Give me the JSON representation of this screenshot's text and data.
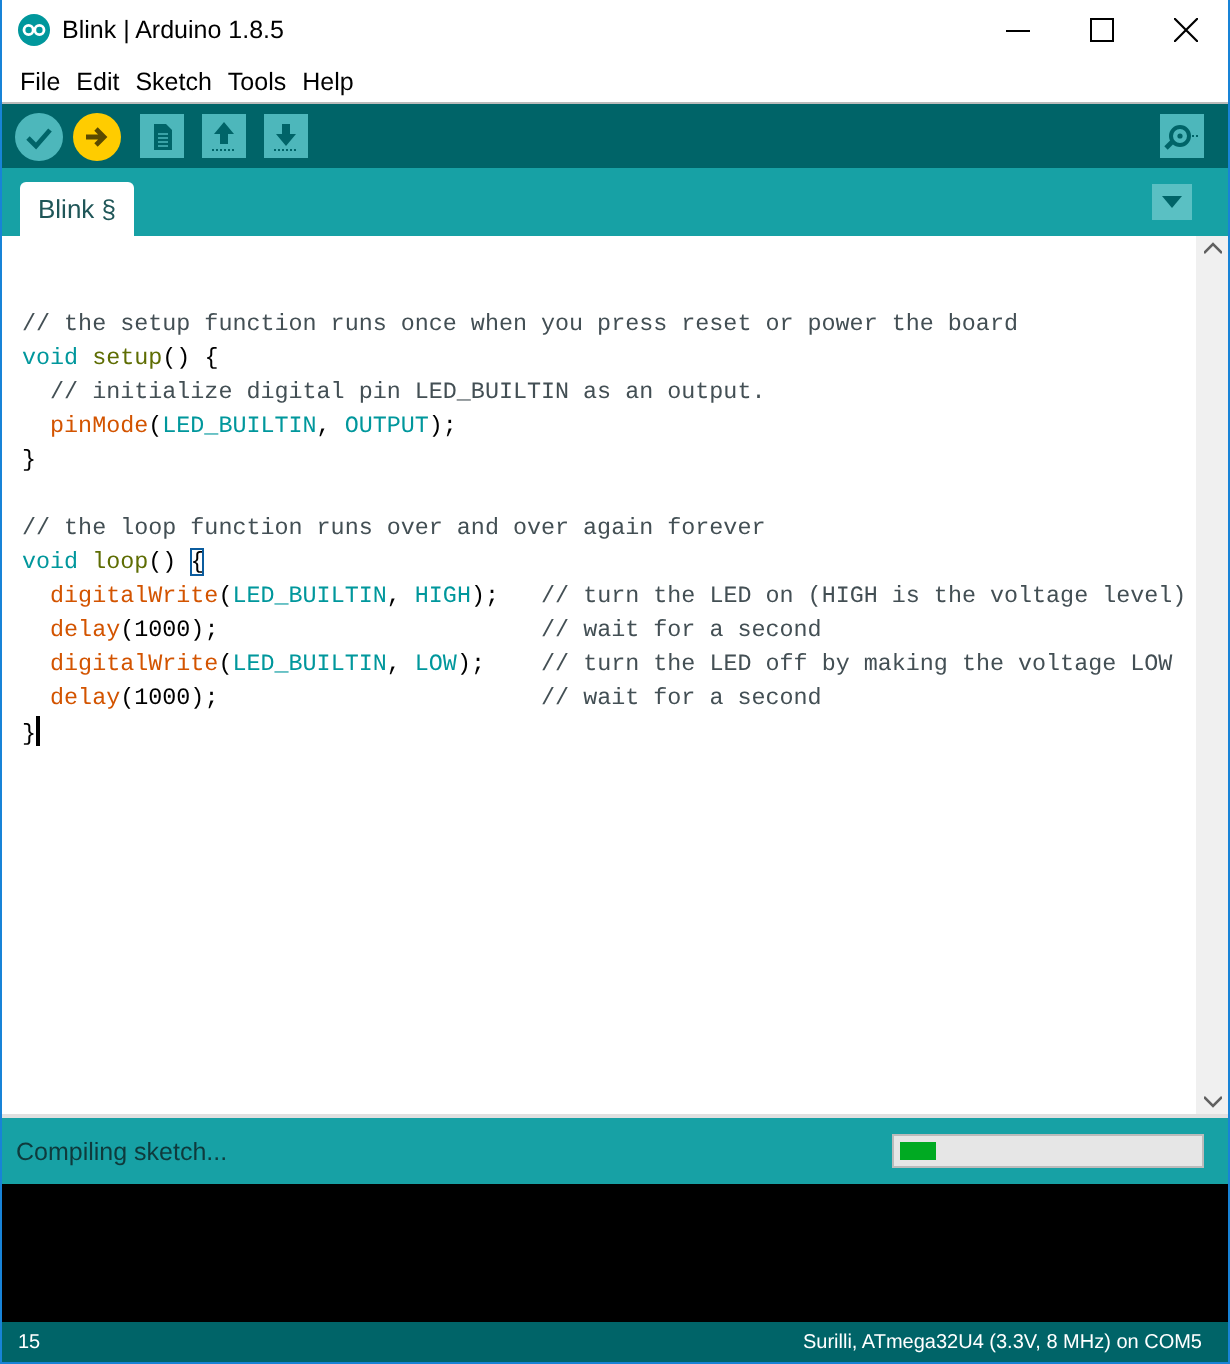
{
  "window": {
    "title": "Blink | Arduino 1.8.5"
  },
  "menu": [
    "File",
    "Edit",
    "Sketch",
    "Tools",
    "Help"
  ],
  "tabs": [
    {
      "label": "Blink §",
      "selected": true
    }
  ],
  "code_blocks": [
    {
      "lines": [
        [
          {
            "kind": "comment",
            "text": "// the setup function runs once when you press reset or power the board"
          }
        ],
        [
          {
            "kind": "keyword",
            "text": "void "
          },
          {
            "kind": "name",
            "text": "setup"
          },
          {
            "kind": "plain",
            "text": "() {"
          }
        ],
        [
          {
            "kind": "comment",
            "text": "  // initialize digital pin LED_BUILTIN as an output."
          }
        ],
        [
          {
            "kind": "function",
            "text": "  pinMode"
          },
          {
            "kind": "plain",
            "text": "("
          },
          {
            "kind": "constant",
            "text": "LED_BUILTIN"
          },
          {
            "kind": "plain",
            "text": ", "
          },
          {
            "kind": "constant",
            "text": "OUTPUT"
          },
          {
            "kind": "plain",
            "text": ");"
          }
        ],
        [
          {
            "kind": "plain",
            "text": "}"
          }
        ]
      ]
    },
    {
      "lines": [
        [
          {
            "kind": "comment",
            "text": "// the loop function runs over and over again forever"
          }
        ],
        [
          {
            "kind": "keyword",
            "text": "void "
          },
          {
            "kind": "name",
            "text": "loop"
          },
          {
            "kind": "plain",
            "text": "() "
          },
          {
            "kind": "matched",
            "text": "{"
          }
        ],
        [
          {
            "kind": "function",
            "text": "  digitalWrite"
          },
          {
            "kind": "plain",
            "text": "("
          },
          {
            "kind": "constant",
            "text": "LED_BUILTIN"
          },
          {
            "kind": "plain",
            "text": ", "
          },
          {
            "kind": "constant",
            "text": "HIGH"
          },
          {
            "kind": "plain",
            "text": ");   "
          },
          {
            "kind": "comment",
            "text": "// turn the LED on (HIGH is the voltage level)"
          }
        ],
        [
          {
            "kind": "function",
            "text": "  delay"
          },
          {
            "kind": "plain",
            "text": "(1000);                       "
          },
          {
            "kind": "comment",
            "text": "// wait for a second"
          }
        ],
        [
          {
            "kind": "function",
            "text": "  digitalWrite"
          },
          {
            "kind": "plain",
            "text": "("
          },
          {
            "kind": "constant",
            "text": "LED_BUILTIN"
          },
          {
            "kind": "plain",
            "text": ", "
          },
          {
            "kind": "constant",
            "text": "LOW"
          },
          {
            "kind": "plain",
            "text": ");    "
          },
          {
            "kind": "comment",
            "text": "// turn the LED off by making the voltage LOW"
          }
        ],
        [
          {
            "kind": "function",
            "text": "  delay"
          },
          {
            "kind": "plain",
            "text": "(1000);                       "
          },
          {
            "kind": "comment",
            "text": "// wait for a second"
          }
        ],
        [
          {
            "kind": "plain",
            "text": "}"
          },
          {
            "kind": "cursor"
          }
        ]
      ]
    }
  ],
  "status": {
    "message": "Compiling sketch...",
    "level": 0.12
  },
  "footer": {
    "line_number": "15",
    "board": "Surilli, ATmega32U4 (3.3V, 8 MHz) on COM5"
  }
}
